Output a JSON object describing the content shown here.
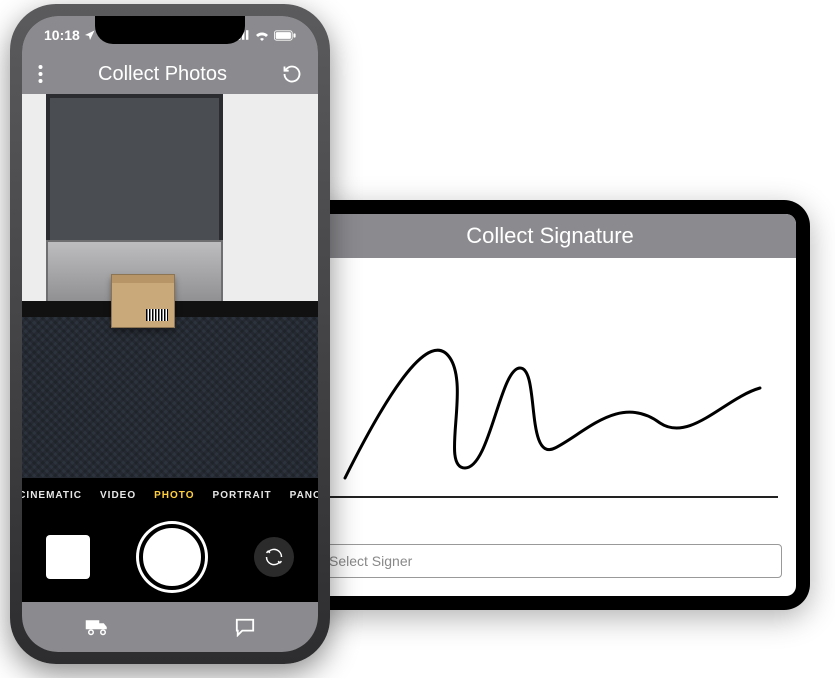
{
  "phone": {
    "status": {
      "time": "10:18"
    },
    "header": {
      "title": "Collect Photos"
    },
    "camera": {
      "modes": {
        "cinematic": "CINEMATIC",
        "video": "VIDEO",
        "photo": "PHOTO",
        "portrait": "PORTRAIT",
        "pano": "PANO"
      },
      "active_mode": "photo"
    }
  },
  "tablet": {
    "header": {
      "title": "Collect Signature"
    },
    "signer_field": {
      "placeholder": "Select Signer"
    }
  }
}
